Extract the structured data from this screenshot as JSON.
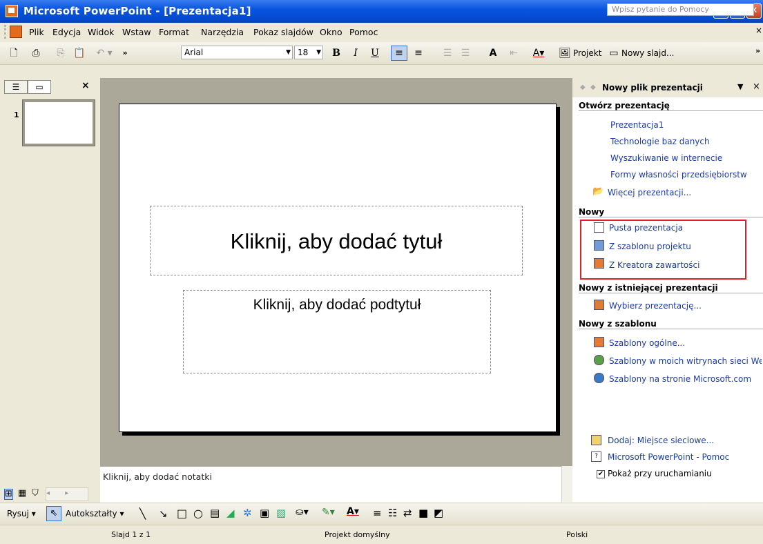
{
  "window": {
    "title": "Microsoft PowerPoint - [Prezentacja1]",
    "minimize_icon": "minimize-icon",
    "maximize_icon": "restore-icon",
    "close_icon": "close-icon"
  },
  "menu": {
    "items": [
      "Plik",
      "Edycja",
      "Widok",
      "Wstaw",
      "Format",
      "Narzędzia",
      "Pokaz slajdów",
      "Okno",
      "Pomoc"
    ],
    "help_placeholder": "Wpisz pytanie do Pomocy"
  },
  "toolbar": {
    "font": "Arial",
    "size": "18",
    "bold": "B",
    "italic": "I",
    "underline": "U",
    "design_label": "Projekt",
    "new_slide_label": "Nowy slajd..."
  },
  "left_pane": {
    "tab_close": "×",
    "slide_number": "1"
  },
  "slide": {
    "title_placeholder": "Kliknij, aby dodać tytuł",
    "subtitle_placeholder": "Kliknij, aby dodać podtytuł"
  },
  "notes": {
    "placeholder": "Kliknij, aby dodać notatki"
  },
  "drawing": {
    "draw_label": "Rysuj",
    "autoshapes_label": "Autokształty"
  },
  "status": {
    "slide": "Slajd 1 z 1",
    "design": "Projekt domyślny",
    "language": "Polski"
  },
  "task_pane": {
    "title": "Nowy plik prezentacji",
    "open_section": "Otwórz prezentację",
    "recent": [
      "Prezentacja1",
      "Technologie baz danych",
      "Wyszukiwanie w internecie",
      "Formy własności przedsiębiorstw"
    ],
    "more": "Więcej prezentacji...",
    "new_section": "Nowy",
    "new_items": [
      "Pusta prezentacja",
      "Z szablonu projektu",
      "Z Kreatora zawartości"
    ],
    "from_existing_section": "Nowy z istniejącej prezentacji",
    "choose_presentation": "Wybierz prezentację...",
    "from_template_section": "Nowy z szablonu",
    "templates": [
      "Szablony ogólne...",
      "Szablony w moich witrynach sieci Web...",
      "Szablony na stronie Microsoft.com"
    ],
    "add_network_place": "Dodaj: Miejsce sieciowe...",
    "help_link": "Microsoft PowerPoint - Pomoc",
    "show_at_startup": "Pokaż przy uruchamianiu",
    "show_at_startup_checked": true,
    "highlight_color": "#e51d26"
  }
}
